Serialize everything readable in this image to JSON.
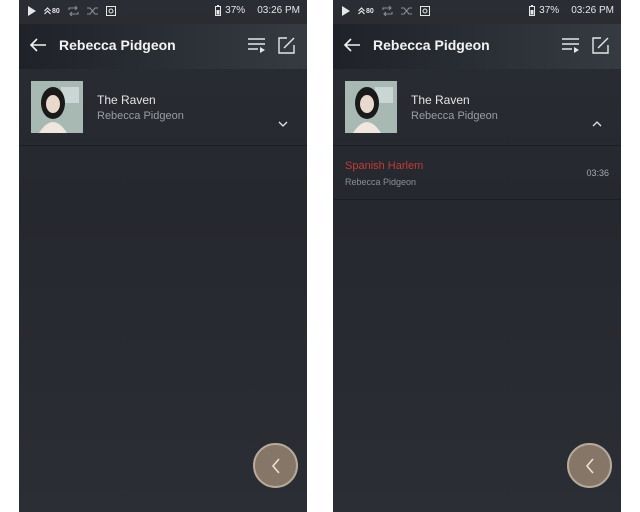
{
  "status_bar": {
    "hi_label": "80",
    "battery": "37%",
    "time": "03:26 PM"
  },
  "header": {
    "title": "Rebecca Pidgeon"
  },
  "album": {
    "title": "The Raven",
    "artist": "Rebecca Pidgeon"
  },
  "tracks": [
    {
      "title": "Spanish Harlem",
      "artist": "Rebecca Pidgeon",
      "duration": "03:36"
    }
  ],
  "colors": {
    "background": "#2a2d33",
    "accent_red": "#c33b35",
    "fab": "#857668"
  },
  "icons": {
    "back": "arrow-left-icon",
    "queue": "queue-icon",
    "edit": "edit-icon",
    "expand": "chevron-down-icon",
    "collapse": "chevron-up-icon",
    "fab": "chevron-left-icon"
  }
}
